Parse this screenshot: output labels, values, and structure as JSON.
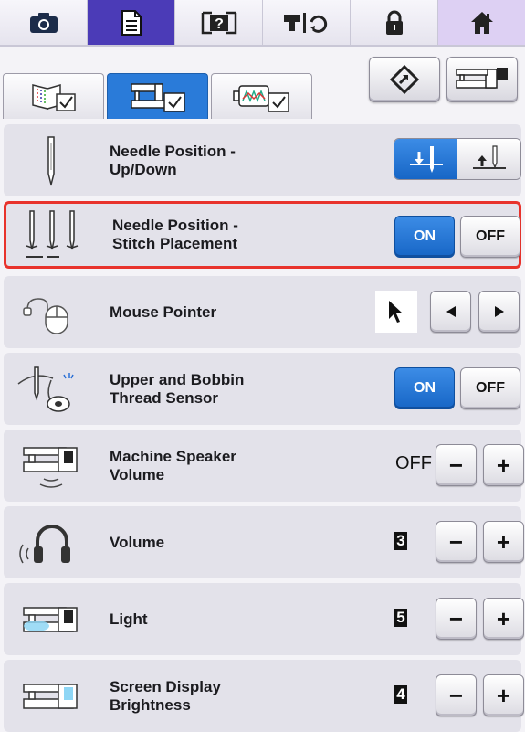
{
  "top_tabs": [
    {
      "icon": "camera-icon"
    },
    {
      "icon": "document-icon"
    },
    {
      "icon": "help-icon",
      "label": "?"
    },
    {
      "icon": "needle-cycle-icon"
    },
    {
      "icon": "lock-icon"
    },
    {
      "icon": "home-icon"
    }
  ],
  "sub_tabs": [
    {
      "icon": "stitch-settings-icon"
    },
    {
      "icon": "machine-settings-icon"
    },
    {
      "icon": "embroidery-settings-icon"
    }
  ],
  "header_buttons": [
    {
      "icon": "reset-icon"
    },
    {
      "icon": "machine-info-icon"
    }
  ],
  "settings": [
    {
      "label": "Needle Position -\nUp/Down",
      "control": "segmented",
      "selected": "down"
    },
    {
      "label": "Needle Position -\nStitch Placement",
      "control": "onoff",
      "on": "ON",
      "off": "OFF",
      "selected": "ON"
    },
    {
      "label": "Mouse Pointer",
      "control": "arrows"
    },
    {
      "label": "Upper and Bobbin\nThread Sensor",
      "control": "onoff",
      "on": "ON",
      "off": "OFF",
      "selected": "ON"
    },
    {
      "label": "Machine Speaker\nVolume",
      "control": "stepper",
      "value": "OFF",
      "minus": "−",
      "plus": "+"
    },
    {
      "label": "Volume",
      "control": "stepper",
      "value": "3",
      "minus": "−",
      "plus": "+"
    },
    {
      "label": "Light",
      "control": "stepper",
      "value": "5",
      "minus": "−",
      "plus": "+"
    },
    {
      "label": "Screen Display\nBrightness",
      "control": "stepper",
      "value": "4",
      "minus": "−",
      "plus": "+"
    }
  ],
  "colors": {
    "accent": "#2a7bd9",
    "active_tab": "#4b3bb7",
    "highlight": "#e8332c",
    "panel": "#e3e2ea"
  }
}
